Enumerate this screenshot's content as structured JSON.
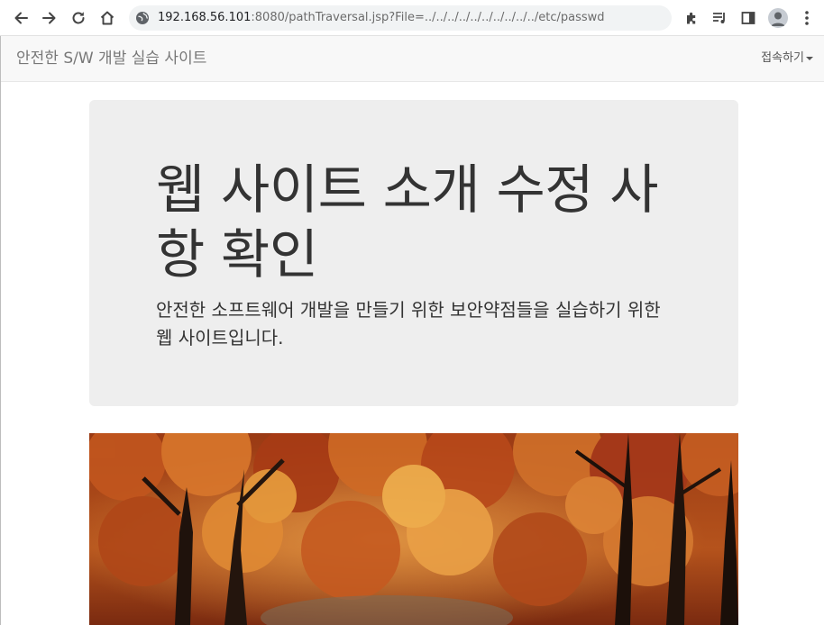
{
  "browser": {
    "url_host": "192.168.56.101",
    "url_rest": ":8080/pathTraversal.jsp?File=../../../../../../../../../../etc/passwd",
    "icons": [
      "back-arrow-icon",
      "forward-arrow-icon",
      "reload-icon",
      "home-icon",
      "site-info-icon",
      "extensions-puzzle-icon",
      "media-queue-icon",
      "side-panel-icon",
      "profile-avatar-icon",
      "more-vertical-icon"
    ]
  },
  "navbar": {
    "brand": "안전한 S/W 개발 실습 사이트",
    "dropdown_label": "접속하기"
  },
  "jumbotron": {
    "title": "웹 사이트 소개 수정 사항 확인",
    "description": "안전한 소프트웨어 개발을 만들기 위한 보안약점들을 실습하기 위한 웹 사이트입니다."
  },
  "image": {
    "subject": "autumn-forest-photo"
  },
  "colors": {
    "navbar_bg": "#f8f8f8",
    "jumbotron_bg": "#eeeeee",
    "text": "#333333",
    "omnibox_bg": "#f1f3f4"
  }
}
